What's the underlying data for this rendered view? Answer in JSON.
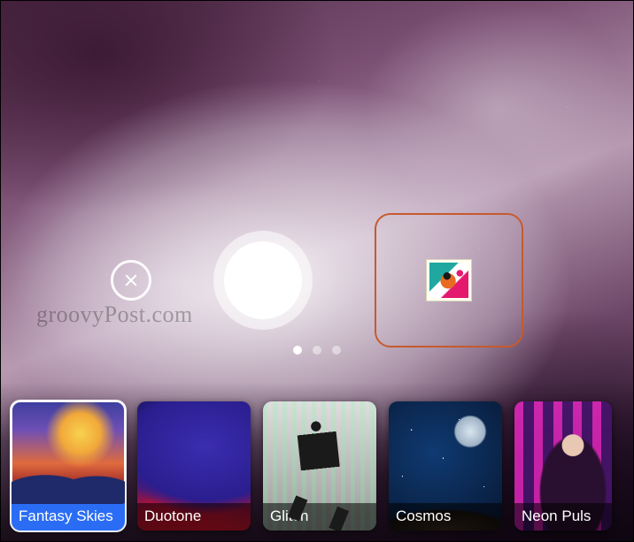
{
  "watermark": "groovyPost.com",
  "pagination": {
    "count": 3,
    "active_index": 0
  },
  "gallery_slot": {
    "highlight_color": "#c65a2e"
  },
  "filters": [
    {
      "id": "fantasy-skies",
      "label": "Fantasy Skies",
      "selected": true,
      "art": "art-fantasy"
    },
    {
      "id": "duotone",
      "label": "Duotone",
      "selected": false,
      "art": "art-duotone"
    },
    {
      "id": "glitch",
      "label": "Glitch",
      "selected": false,
      "art": "art-glitch"
    },
    {
      "id": "cosmos",
      "label": "Cosmos",
      "selected": false,
      "art": "art-cosmos"
    },
    {
      "id": "neon-pulse",
      "label": "Neon Puls",
      "selected": false,
      "art": "art-neon",
      "truncated": true
    }
  ]
}
